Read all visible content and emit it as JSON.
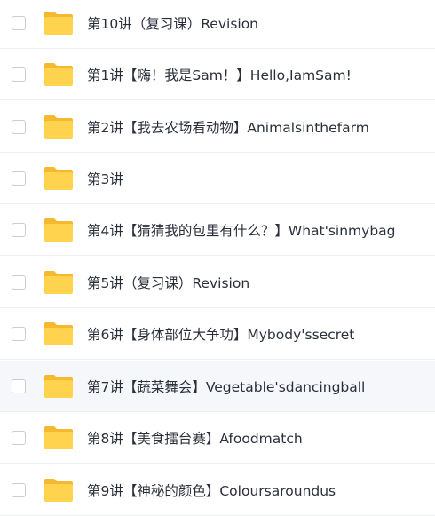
{
  "colors": {
    "folder_body": "#ffd34e",
    "folder_back": "#f5b82e",
    "text": "#2a2f3a",
    "divider": "#eef0f3",
    "highlight_row": "#f5f7fa"
  },
  "files": [
    {
      "name": "第10讲（复习课）Revision",
      "icon": "folder-icon",
      "selected": false
    },
    {
      "name": "第1讲【嗨！我是Sam！】Hello,IamSam!",
      "icon": "folder-icon",
      "selected": false
    },
    {
      "name": "第2讲【我去农场看动物】Animalsinthefarm",
      "icon": "folder-icon",
      "selected": false
    },
    {
      "name": "第3讲",
      "icon": "folder-icon",
      "selected": false
    },
    {
      "name": "第4讲【猜猜我的包里有什么？】What'sinmybag",
      "icon": "folder-icon",
      "selected": false
    },
    {
      "name": "第5讲（复习课）Revision",
      "icon": "folder-icon",
      "selected": false
    },
    {
      "name": "第6讲【身体部位大争功】Mybody'ssecret",
      "icon": "folder-icon",
      "selected": false
    },
    {
      "name": "第7讲【蔬菜舞会】Vegetable'sdancingball",
      "icon": "folder-icon",
      "selected": false
    },
    {
      "name": "第8讲【美食擂台赛】Afoodmatch",
      "icon": "folder-icon",
      "selected": false
    },
    {
      "name": "第9讲【神秘的颜色】Coloursaroundus",
      "icon": "folder-icon",
      "selected": false
    }
  ]
}
